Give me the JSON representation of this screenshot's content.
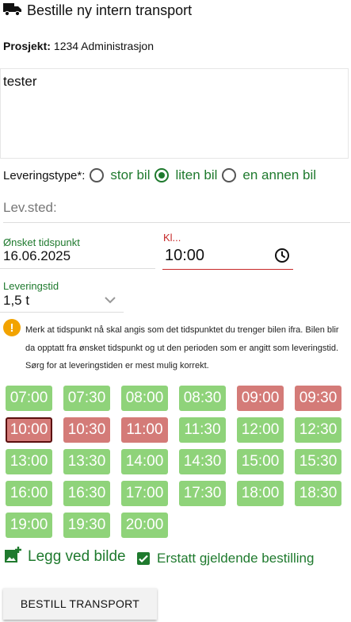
{
  "header": {
    "title": "Bestille ny intern transport",
    "icon": "truck-icon"
  },
  "project": {
    "label": "Prosjekt:",
    "value": "1234 Administrasjon"
  },
  "notes": {
    "value": "tester"
  },
  "delivery_type": {
    "label": "Leveringstype*:",
    "options": [
      {
        "label": "stor bil",
        "selected": false
      },
      {
        "label": "liten bil",
        "selected": true
      },
      {
        "label": "en annen bil",
        "selected": false
      }
    ]
  },
  "location": {
    "placeholder": "Lev.sted:"
  },
  "date": {
    "label": "Ønsket tidspunkt",
    "value": "16.06.2025"
  },
  "time": {
    "label": "Kl...",
    "value": "10:00"
  },
  "duration": {
    "label": "Leveringstid",
    "value": "1,5 t"
  },
  "info": {
    "text": "Merk at tidspunkt nå skal angis som det tidspunktet du trenger bilen ifra. Bilen blir da opptatt fra ønsket tidspunkt og ut den perioden som er angitt som leveringstid. Sørg for at leveringstiden er mest mulig korrekt."
  },
  "slots": [
    {
      "t": "07:00",
      "s": "free"
    },
    {
      "t": "07:30",
      "s": "free"
    },
    {
      "t": "08:00",
      "s": "free"
    },
    {
      "t": "08:30",
      "s": "free"
    },
    {
      "t": "09:00",
      "s": "busy"
    },
    {
      "t": "09:30",
      "s": "busy"
    },
    {
      "t": "10:00",
      "s": "selected"
    },
    {
      "t": "10:30",
      "s": "busy"
    },
    {
      "t": "11:00",
      "s": "busy"
    },
    {
      "t": "11:30",
      "s": "free"
    },
    {
      "t": "12:00",
      "s": "free"
    },
    {
      "t": "12:30",
      "s": "free"
    },
    {
      "t": "13:00",
      "s": "free"
    },
    {
      "t": "13:30",
      "s": "free"
    },
    {
      "t": "14:00",
      "s": "free"
    },
    {
      "t": "14:30",
      "s": "free"
    },
    {
      "t": "15:00",
      "s": "free"
    },
    {
      "t": "15:30",
      "s": "free"
    },
    {
      "t": "16:00",
      "s": "free"
    },
    {
      "t": "16:30",
      "s": "free"
    },
    {
      "t": "17:00",
      "s": "free"
    },
    {
      "t": "17:30",
      "s": "free"
    },
    {
      "t": "18:00",
      "s": "free"
    },
    {
      "t": "18:30",
      "s": "free"
    },
    {
      "t": "19:00",
      "s": "free"
    },
    {
      "t": "19:30",
      "s": "free"
    },
    {
      "t": "20:00",
      "s": "free"
    }
  ],
  "attach": {
    "label": "Legg ved bilde",
    "icon": "add-photo-icon"
  },
  "replace": {
    "label": "Erstatt gjeldende bestilling",
    "checked": true
  },
  "submit": {
    "label": "BESTILL TRANSPORT"
  },
  "colors": {
    "accent": "#1f7a2e",
    "free_slot": "#8fd37a",
    "busy_slot": "#d47b78",
    "warning": "#f2a300",
    "error": "#c62828"
  }
}
